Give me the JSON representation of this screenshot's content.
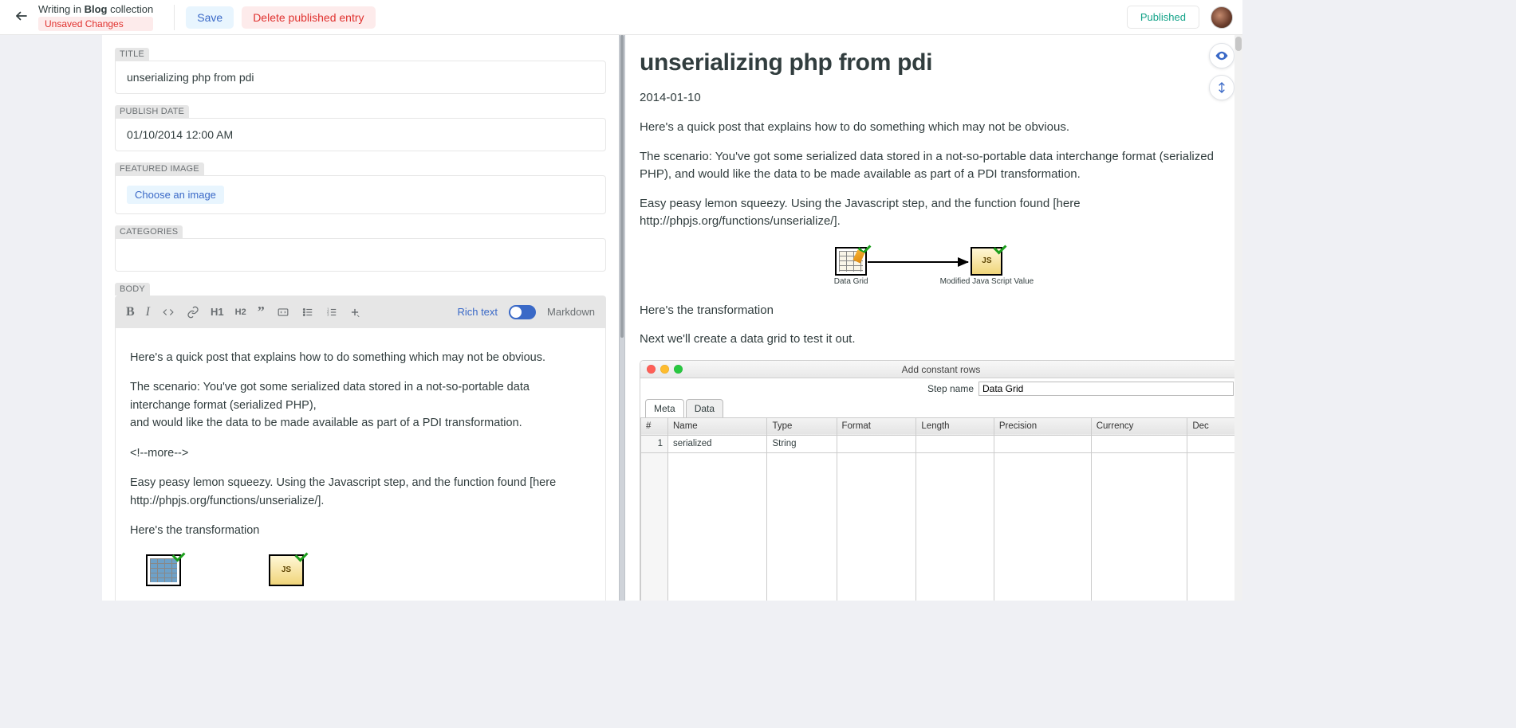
{
  "toolbar": {
    "back_aria": "Back",
    "writing_in": "Writing in ",
    "collection_name": "Blog",
    "collection_suffix": " collection",
    "unsaved_label": "Unsaved Changes",
    "save_label": "Save",
    "delete_label": "Delete published entry",
    "published_label": "Published"
  },
  "fields": {
    "title_label": "TITLE",
    "title_value": "unserializing php from pdi",
    "date_label": "PUBLISH DATE",
    "date_value": "01/10/2014 12:00 AM",
    "image_label": "FEATURED IMAGE",
    "choose_image_label": "Choose an image",
    "categories_label": "CATEGORIES",
    "body_label": "BODY"
  },
  "body_toolbar": {
    "mode_rich": "Rich text",
    "mode_md": "Markdown",
    "h1": "H1",
    "h2": "H2"
  },
  "body_text": {
    "p1": "Here's a quick post that explains how to do something which may not be obvious.",
    "p2a": "The scenario: You've got some serialized data stored in a not-so-portable data interchange format (serialized PHP),",
    "p2b": "and would like the data to be made available as part of a PDI transformation.",
    "p3": "<!--more-->",
    "p4": "Easy peasy lemon squeezy. Using the Javascript step, and the function found [here http://phpjs.org/functions/unserialize/].",
    "p5": "Here's the transformation"
  },
  "preview": {
    "title": "unserializing php from pdi",
    "date": "2014-01-10",
    "p1": "Here's a quick post that explains how to do something which may not be obvious.",
    "p2": "The scenario: You've got some serialized data stored in a not-so-portable data interchange format (serialized PHP), and would like the data to be made available as part of a PDI transformation.",
    "p3": "Easy peasy lemon squeezy. Using the Javascript step, and the function found [here http://phpjs.org/functions/unserialize/].",
    "flow_node1": "Data Grid",
    "flow_node2": "Modified Java Script Value",
    "p4": "Here's the transformation",
    "p5": "Next we'll create a data grid to test it out."
  },
  "macwin": {
    "title": "Add constant rows",
    "stepname_label": "Step name",
    "stepname_value": "Data Grid",
    "tab_meta": "Meta",
    "tab_data": "Data",
    "columns": [
      "#",
      "Name",
      "Type",
      "Format",
      "Length",
      "Precision",
      "Currency",
      "Dec"
    ],
    "row1_num": "1",
    "row1_name": "serialized",
    "row1_type": "String"
  },
  "icons": {
    "js": "JS"
  }
}
